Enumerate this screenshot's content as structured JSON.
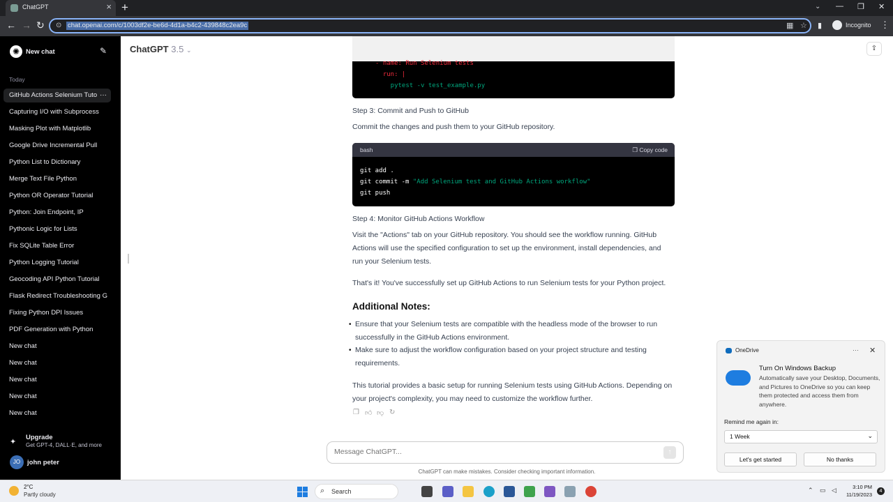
{
  "browser": {
    "tab_title": "ChatGPT",
    "url": "chat.openai.com/c/1003df2e-be6d-4d1a-b4c2-439848c2ea9c",
    "mode_label": "Incognito"
  },
  "sidebar": {
    "new_chat": "New chat",
    "section": "Today",
    "items": [
      {
        "label": "GitHub Actions Selenium Tuto"
      },
      {
        "label": "Capturing I/O with Subprocess"
      },
      {
        "label": "Masking Plot with Matplotlib"
      },
      {
        "label": "Google Drive Incremental Pull"
      },
      {
        "label": "Python List to Dictionary"
      },
      {
        "label": "Merge Text File Python"
      },
      {
        "label": "Python OR Operator Tutorial"
      },
      {
        "label": "Python: Join Endpoint, IP"
      },
      {
        "label": "Pythonic Logic for Lists"
      },
      {
        "label": "Fix SQLite Table Error"
      },
      {
        "label": "Python Logging Tutorial"
      },
      {
        "label": "Geocoding API Python Tutorial"
      },
      {
        "label": "Flask Redirect Troubleshooting G"
      },
      {
        "label": "Fixing Python DPI Issues"
      },
      {
        "label": "PDF Generation with Python"
      },
      {
        "label": "New chat"
      },
      {
        "label": "New chat"
      },
      {
        "label": "New chat"
      },
      {
        "label": "New chat"
      },
      {
        "label": "New chat"
      }
    ],
    "upgrade": "Upgrade",
    "upgrade_sub": "Get GPT-4, DALL·E, and more",
    "avatar_initials": "JO",
    "user_name": "john peter"
  },
  "header": {
    "model": "ChatGPT",
    "version": "3.5"
  },
  "content": {
    "code1": {
      "line1": "- name: Run Selenium tests",
      "line2": "  run: |",
      "line3": "    pytest -v test_example.py"
    },
    "step3_title": "Step 3: Commit and Push to GitHub",
    "step3_text": "Commit the changes and push them to your GitHub repository.",
    "code2": {
      "lang": "bash",
      "copy": "Copy code",
      "line1": "git add .",
      "line2_cmd": "git commit -m ",
      "line2_str": "\"Add Selenium test and GitHub Actions workflow\"",
      "line3": "git push"
    },
    "step4_title": "Step 4: Monitor GitHub Actions Workflow",
    "step4_text": "Visit the \"Actions\" tab on your GitHub repository. You should see the workflow running. GitHub Actions will use the specified configuration to set up the environment, install dependencies, and run your Selenium tests.",
    "summary": "That's it! You've successfully set up GitHub Actions to run Selenium tests for your Python project.",
    "notes_title": "Additional Notes:",
    "note1": "Ensure that your Selenium tests are compatible with the headless mode of the browser to run successfully in the GitHub Actions environment.",
    "note2": "Make sure to adjust the workflow configuration based on your project structure and testing requirements.",
    "closing": "This tutorial provides a basic setup for running Selenium tests using GitHub Actions. Depending on your project's complexity, you may need to customize the workflow further."
  },
  "composer": {
    "placeholder": "Message ChatGPT...",
    "disclaimer": "ChatGPT can make mistakes. Consider checking important information."
  },
  "toast": {
    "app": "OneDrive",
    "title": "Turn On Windows Backup",
    "body": "Automatically save your Desktop, Documents, and Pictures to OneDrive so you can keep them protected and access them from anywhere.",
    "remind_label": "Remind me again in:",
    "remind_value": "1 Week",
    "primary": "Let's get started",
    "secondary": "No thanks"
  },
  "taskbar": {
    "temp": "2°C",
    "condition": "Partly cloudy",
    "search": "Search",
    "time": "3:10 PM",
    "date": "11/19/2023",
    "notifications": "4"
  }
}
